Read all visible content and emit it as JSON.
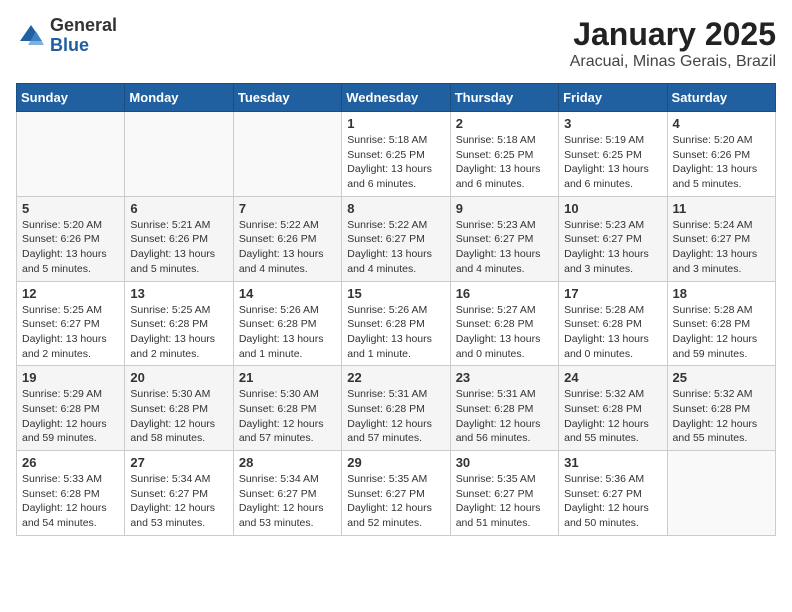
{
  "logo": {
    "general": "General",
    "blue": "Blue"
  },
  "title": "January 2025",
  "subtitle": "Aracuai, Minas Gerais, Brazil",
  "days_of_week": [
    "Sunday",
    "Monday",
    "Tuesday",
    "Wednesday",
    "Thursday",
    "Friday",
    "Saturday"
  ],
  "weeks": [
    [
      {
        "day": "",
        "details": ""
      },
      {
        "day": "",
        "details": ""
      },
      {
        "day": "",
        "details": ""
      },
      {
        "day": "1",
        "details": "Sunrise: 5:18 AM\nSunset: 6:25 PM\nDaylight: 13 hours and 6 minutes."
      },
      {
        "day": "2",
        "details": "Sunrise: 5:18 AM\nSunset: 6:25 PM\nDaylight: 13 hours and 6 minutes."
      },
      {
        "day": "3",
        "details": "Sunrise: 5:19 AM\nSunset: 6:25 PM\nDaylight: 13 hours and 6 minutes."
      },
      {
        "day": "4",
        "details": "Sunrise: 5:20 AM\nSunset: 6:26 PM\nDaylight: 13 hours and 5 minutes."
      }
    ],
    [
      {
        "day": "5",
        "details": "Sunrise: 5:20 AM\nSunset: 6:26 PM\nDaylight: 13 hours and 5 minutes."
      },
      {
        "day": "6",
        "details": "Sunrise: 5:21 AM\nSunset: 6:26 PM\nDaylight: 13 hours and 5 minutes."
      },
      {
        "day": "7",
        "details": "Sunrise: 5:22 AM\nSunset: 6:26 PM\nDaylight: 13 hours and 4 minutes."
      },
      {
        "day": "8",
        "details": "Sunrise: 5:22 AM\nSunset: 6:27 PM\nDaylight: 13 hours and 4 minutes."
      },
      {
        "day": "9",
        "details": "Sunrise: 5:23 AM\nSunset: 6:27 PM\nDaylight: 13 hours and 4 minutes."
      },
      {
        "day": "10",
        "details": "Sunrise: 5:23 AM\nSunset: 6:27 PM\nDaylight: 13 hours and 3 minutes."
      },
      {
        "day": "11",
        "details": "Sunrise: 5:24 AM\nSunset: 6:27 PM\nDaylight: 13 hours and 3 minutes."
      }
    ],
    [
      {
        "day": "12",
        "details": "Sunrise: 5:25 AM\nSunset: 6:27 PM\nDaylight: 13 hours and 2 minutes."
      },
      {
        "day": "13",
        "details": "Sunrise: 5:25 AM\nSunset: 6:28 PM\nDaylight: 13 hours and 2 minutes."
      },
      {
        "day": "14",
        "details": "Sunrise: 5:26 AM\nSunset: 6:28 PM\nDaylight: 13 hours and 1 minute."
      },
      {
        "day": "15",
        "details": "Sunrise: 5:26 AM\nSunset: 6:28 PM\nDaylight: 13 hours and 1 minute."
      },
      {
        "day": "16",
        "details": "Sunrise: 5:27 AM\nSunset: 6:28 PM\nDaylight: 13 hours and 0 minutes."
      },
      {
        "day": "17",
        "details": "Sunrise: 5:28 AM\nSunset: 6:28 PM\nDaylight: 13 hours and 0 minutes."
      },
      {
        "day": "18",
        "details": "Sunrise: 5:28 AM\nSunset: 6:28 PM\nDaylight: 12 hours and 59 minutes."
      }
    ],
    [
      {
        "day": "19",
        "details": "Sunrise: 5:29 AM\nSunset: 6:28 PM\nDaylight: 12 hours and 59 minutes."
      },
      {
        "day": "20",
        "details": "Sunrise: 5:30 AM\nSunset: 6:28 PM\nDaylight: 12 hours and 58 minutes."
      },
      {
        "day": "21",
        "details": "Sunrise: 5:30 AM\nSunset: 6:28 PM\nDaylight: 12 hours and 57 minutes."
      },
      {
        "day": "22",
        "details": "Sunrise: 5:31 AM\nSunset: 6:28 PM\nDaylight: 12 hours and 57 minutes."
      },
      {
        "day": "23",
        "details": "Sunrise: 5:31 AM\nSunset: 6:28 PM\nDaylight: 12 hours and 56 minutes."
      },
      {
        "day": "24",
        "details": "Sunrise: 5:32 AM\nSunset: 6:28 PM\nDaylight: 12 hours and 55 minutes."
      },
      {
        "day": "25",
        "details": "Sunrise: 5:32 AM\nSunset: 6:28 PM\nDaylight: 12 hours and 55 minutes."
      }
    ],
    [
      {
        "day": "26",
        "details": "Sunrise: 5:33 AM\nSunset: 6:28 PM\nDaylight: 12 hours and 54 minutes."
      },
      {
        "day": "27",
        "details": "Sunrise: 5:34 AM\nSunset: 6:27 PM\nDaylight: 12 hours and 53 minutes."
      },
      {
        "day": "28",
        "details": "Sunrise: 5:34 AM\nSunset: 6:27 PM\nDaylight: 12 hours and 53 minutes."
      },
      {
        "day": "29",
        "details": "Sunrise: 5:35 AM\nSunset: 6:27 PM\nDaylight: 12 hours and 52 minutes."
      },
      {
        "day": "30",
        "details": "Sunrise: 5:35 AM\nSunset: 6:27 PM\nDaylight: 12 hours and 51 minutes."
      },
      {
        "day": "31",
        "details": "Sunrise: 5:36 AM\nSunset: 6:27 PM\nDaylight: 12 hours and 50 minutes."
      },
      {
        "day": "",
        "details": ""
      }
    ]
  ]
}
